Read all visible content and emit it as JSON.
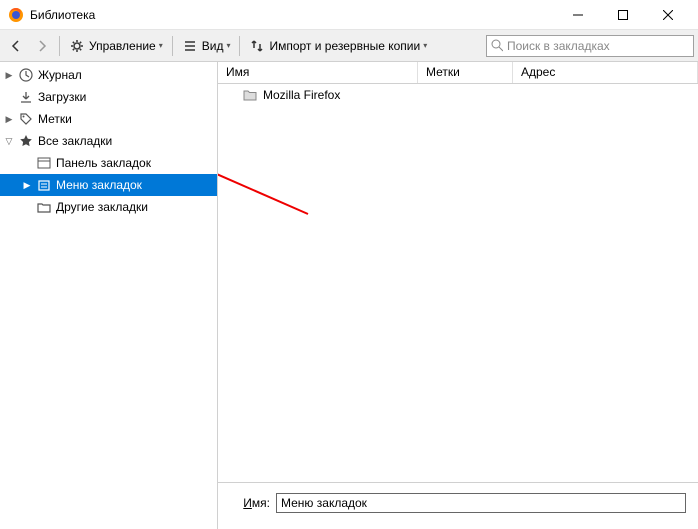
{
  "window": {
    "title": "Библиотека"
  },
  "toolbar": {
    "organize": "Управление",
    "view": "Вид",
    "import": "Импорт и резервные копии",
    "search_placeholder": "Поиск в закладках"
  },
  "sidebar": {
    "history": "Журнал",
    "downloads": "Загрузки",
    "tags": "Метки",
    "all_bookmarks": "Все закладки",
    "toolbar_bookmarks": "Панель закладок",
    "menu_bookmarks": "Меню закладок",
    "other_bookmarks": "Другие закладки"
  },
  "columns": {
    "name": "Имя",
    "tags": "Метки",
    "address": "Адрес"
  },
  "list": {
    "items": [
      {
        "label": "Mozilla Firefox"
      }
    ]
  },
  "details": {
    "name_label": "Имя:",
    "name_value": "Меню закладок"
  }
}
